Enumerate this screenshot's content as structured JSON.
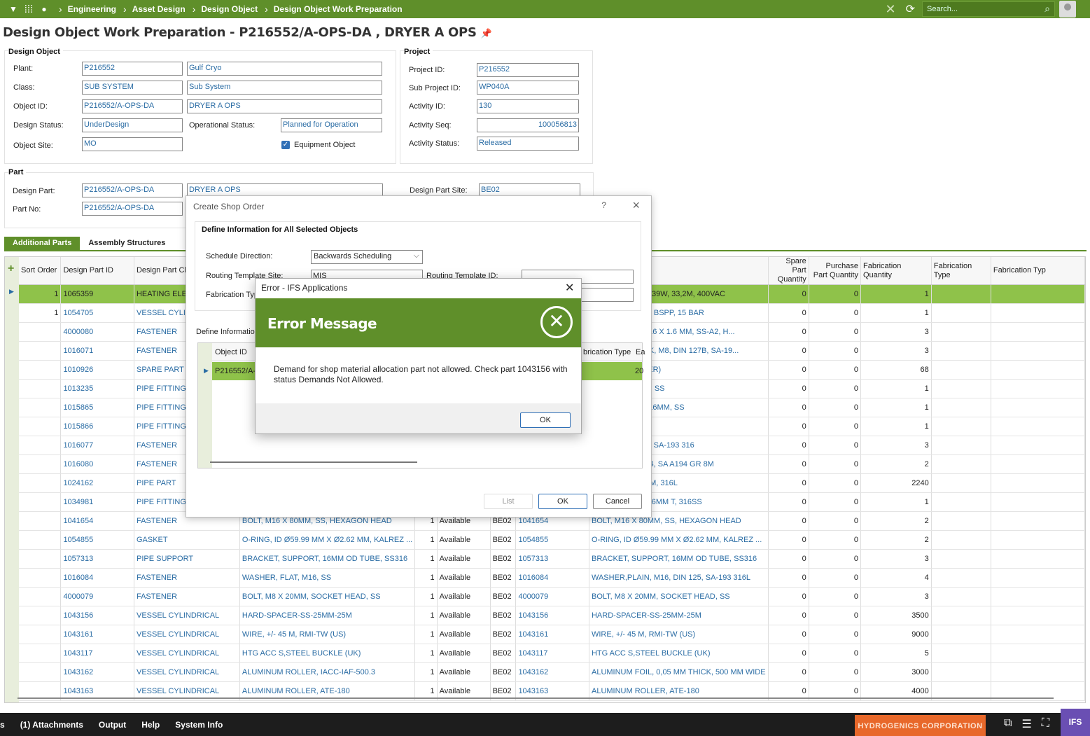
{
  "topbar": {
    "breadcrumbs": [
      "Engineering",
      "Asset Design",
      "Design Object",
      "Design Object Work Preparation"
    ],
    "search_placeholder": "Search..."
  },
  "page_title": "Design Object Work Preparation - P216552/A-OPS-DA , DRYER A OPS",
  "design_object": {
    "title": "Design Object",
    "plant_label": "Plant:",
    "plant": "P216552",
    "plant_desc": "Gulf Cryo",
    "class_label": "Class:",
    "class": "SUB SYSTEM",
    "class_desc": "Sub System",
    "object_id_label": "Object ID:",
    "object_id": "P216552/A-OPS-DA",
    "object_desc": "DRYER A OPS",
    "design_status_label": "Design Status:",
    "design_status": "UnderDesign",
    "op_status_label": "Operational Status:",
    "op_status": "Planned for Operation",
    "object_site_label": "Object Site:",
    "object_site": "MO",
    "equipment_label": "Equipment Object"
  },
  "project": {
    "title": "Project",
    "project_id_label": "Project ID:",
    "project_id": "P216552",
    "sub_project_label": "Sub Project ID:",
    "sub_project": "WP040A",
    "activity_id_label": "Activity ID:",
    "activity_id": "130",
    "activity_seq_label": "Activity Seq:",
    "activity_seq": "100056813",
    "activity_status_label": "Activity Status:",
    "activity_status": "Released"
  },
  "part": {
    "title": "Part",
    "design_part_label": "Design Part:",
    "design_part": "P216552/A-OPS-DA",
    "design_part_desc": "DRYER A OPS",
    "design_part_site_label": "Design Part Site:",
    "design_part_site": "BE02",
    "part_no_label": "Part No:",
    "part_no": "P216552/A-OPS-DA"
  },
  "tabs": [
    "Additional Parts",
    "Assembly Structures"
  ],
  "grid": {
    "headers": [
      "Sort Order",
      "Design Part ID",
      "Design Part Cl",
      "",
      "",
      "",
      "",
      "",
      "escription",
      "Spare Part Quantity",
      "Purchase Part Quantity",
      "Fabrication Quantity",
      "Fabrication Type",
      "Fabrication Typ"
    ],
    "rows": [
      [
        "1",
        "1065359",
        "HEATING ELEC",
        "",
        "",
        "",
        "",
        "",
        "NT, HEATING, 2939W, 33,2M, 400VAC",
        "0",
        "0",
        "1"
      ],
      [
        "1",
        "1054705",
        "VESSEL CYLI",
        "",
        "",
        "",
        "",
        "",
        "L, DIA 273MM, 2\" BSPP, 15 BAR",
        "0",
        "0",
        "1"
      ],
      [
        "",
        "4000080",
        "FASTENER",
        "",
        "",
        "",
        "",
        "",
        "ER, FLAT, M8 X 16 X 1.6 MM, SS-A2, H...",
        "0",
        "0",
        "3"
      ],
      [
        "",
        "1016071",
        "FASTENER",
        "",
        "",
        "",
        "",
        "",
        "ER, PLAIN, LOCK, M8, DIN 127B, SA-19...",
        "0",
        "0",
        "3"
      ],
      [
        "",
        "1010926",
        "SPARE PART",
        "",
        "",
        "",
        "",
        "",
        "V, (IGEN 15 DRIER)",
        "0",
        "0",
        "68"
      ],
      [
        "",
        "1013235",
        "PIPE FITTING",
        "",
        "",
        "",
        "",
        "",
        "NION, 16MM OD, SS",
        "0",
        "0",
        "1"
      ],
      [
        "",
        "1015865",
        "PIPE FITTING",
        "",
        "",
        "",
        "",
        "",
        "TUBE FITTING, 16MM, SS",
        "0",
        "0",
        "1"
      ],
      [
        "",
        "1015866",
        "PIPE FITTING",
        "",
        "",
        "",
        "",
        "",
        ", 16MM OD, SS",
        "0",
        "0",
        "1"
      ],
      [
        "",
        "1016077",
        "FASTENER",
        "",
        "",
        "",
        "",
        "",
        "EX, M8, DIN 934, SA-193 316",
        "0",
        "0",
        "3"
      ],
      [
        "",
        "1016080",
        "FASTENER",
        "",
        "",
        "",
        "",
        "",
        "EX, M16,  DIN 934, SA A194 GR 8M",
        "0",
        "0",
        "2"
      ],
      [
        "",
        "1024162",
        "PIPE PART",
        "",
        "",
        "",
        "",
        "",
        "G, 16MM X 1.5MM, 316L",
        "0",
        "0",
        "2240"
      ],
      [
        "",
        "1034981",
        "PIPE FITTING",
        "",
        "",
        "",
        "",
        "",
        "ECTOR, PORT, 16MM T, 316SS",
        "0",
        "0",
        "1"
      ],
      [
        "",
        "1041654",
        "FASTENER",
        "BOLT, M16 X 80MM, SS, HEXAGON HEAD",
        "1",
        "Available",
        "BE02",
        "1041654",
        "BOLT, M16 X 80MM, SS, HEXAGON HEAD",
        "0",
        "0",
        "2"
      ],
      [
        "",
        "1054855",
        "GASKET",
        "O-RING, ID Ø59.99 MM X Ø2.62 MM, KALREZ ...",
        "1",
        "Available",
        "BE02",
        "1054855",
        "O-RING, ID Ø59.99 MM X Ø2.62 MM, KALREZ ...",
        "0",
        "0",
        "2"
      ],
      [
        "",
        "1057313",
        "PIPE SUPPORT",
        "BRACKET, SUPPORT, 16MM OD TUBE, SS316",
        "1",
        "Available",
        "BE02",
        "1057313",
        "BRACKET, SUPPORT, 16MM OD TUBE, SS316",
        "0",
        "0",
        "3"
      ],
      [
        "",
        "1016084",
        "FASTENER",
        "WASHER, FLAT, M16, SS",
        "1",
        "Available",
        "BE02",
        "1016084",
        "WASHER,PLAIN, M16, DIN 125, SA-193 316L",
        "0",
        "0",
        "4"
      ],
      [
        "",
        "4000079",
        "FASTENER",
        "BOLT, M8 X 20MM, SOCKET HEAD, SS",
        "1",
        "Available",
        "BE02",
        "4000079",
        "BOLT, M8 X 20MM, SOCKET HEAD, SS",
        "0",
        "0",
        "3"
      ],
      [
        "",
        "1043156",
        "VESSEL CYLINDRICAL",
        "HARD-SPACER-SS-25MM-25M",
        "1",
        "Available",
        "BE02",
        "1043156",
        "HARD-SPACER-SS-25MM-25M",
        "0",
        "0",
        "3500"
      ],
      [
        "",
        "1043161",
        "VESSEL CYLINDRICAL",
        "WIRE, +/- 45 M, RMI-TW (US)",
        "1",
        "Available",
        "BE02",
        "1043161",
        "WIRE, +/- 45 M, RMI-TW (US)",
        "0",
        "0",
        "9000"
      ],
      [
        "",
        "1043117",
        "VESSEL CYLINDRICAL",
        "HTG ACC S,STEEL BUCKLE (UK)",
        "1",
        "Available",
        "BE02",
        "1043117",
        "HTG ACC S,STEEL BUCKLE (UK)",
        "0",
        "0",
        "5"
      ],
      [
        "",
        "1043162",
        "VESSEL CYLINDRICAL",
        "ALUMINUM ROLLER, IACC-IAF-500.3",
        "1",
        "Available",
        "BE02",
        "1043162",
        "ALUMINUM FOIL, 0,05 MM THICK, 500 MM WIDE",
        "0",
        "0",
        "3000"
      ],
      [
        "",
        "1043163",
        "VESSEL CYLINDRICAL",
        "ALUMINUM ROLLER, ATE-180",
        "1",
        "Available",
        "BE02",
        "1043163",
        "ALUMINUM ROLLER, ATE-180",
        "0",
        "0",
        "4000"
      ]
    ]
  },
  "create_dialog": {
    "title": "Create Shop Order",
    "help": "?",
    "group_title": "Define Information for All Selected Objects",
    "schedule_label": "Schedule Direction:",
    "schedule_value": "Backwards Scheduling",
    "routing_site_label": "Routing Template Site:",
    "routing_site_value": "MIS",
    "routing_id_label": "Routing Template ID:",
    "fabrication_label": "Fabrication Typ",
    "define_info_label": "Define Informatio",
    "col_object_id": "Object ID",
    "col_fab_type": "brication Type",
    "col_ea": "Ea",
    "row_object": "P216552/A-(",
    "row_ea": "20",
    "btn_list": "List",
    "btn_ok": "OK",
    "btn_cancel": "Cancel"
  },
  "error_dialog": {
    "window_title": "Error - IFS Applications",
    "heading": "Error Message",
    "message": "Demand for shop material allocation part not allowed. Check part 1043156 with status Demands Not Allowed.",
    "ok": "OK"
  },
  "bottombar": {
    "items": [
      "s",
      "(1) Attachments",
      "Output",
      "Help",
      "System Info"
    ],
    "company": "HYDROGENICS CORPORATION",
    "logo": "IFS"
  }
}
